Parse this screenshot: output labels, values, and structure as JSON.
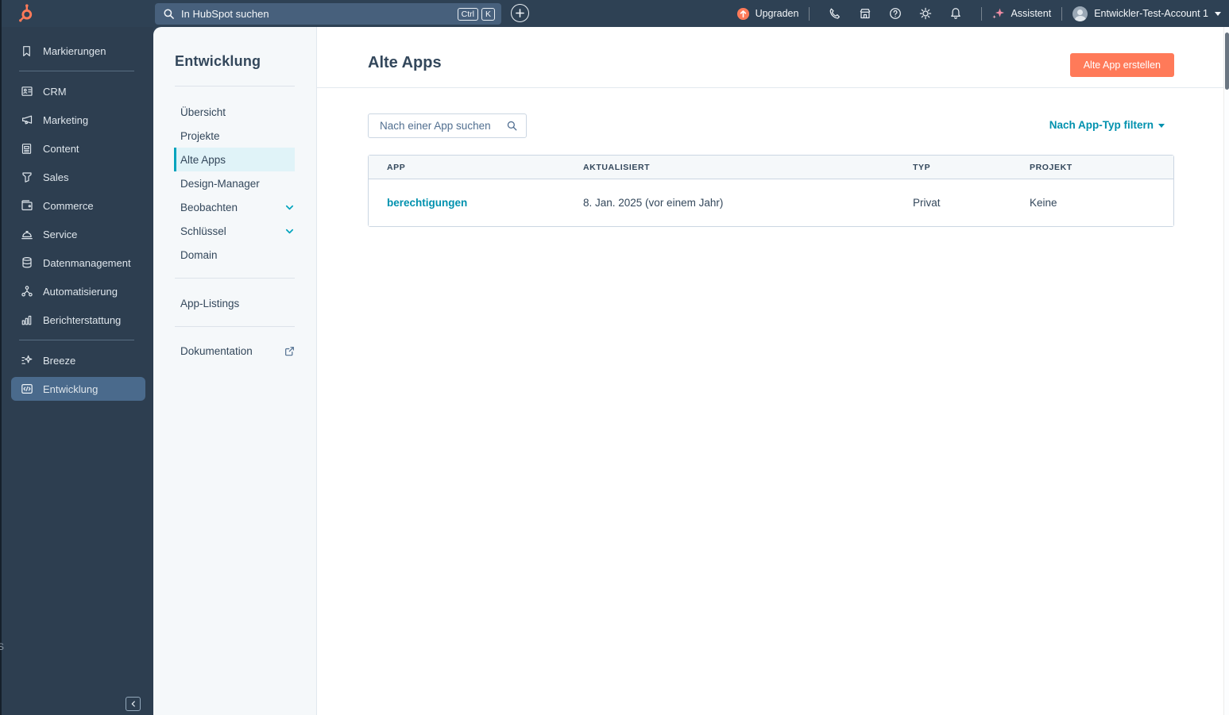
{
  "topbar": {
    "search_placeholder": "In HubSpot suchen",
    "shortcut_keys": [
      "Ctrl",
      "K"
    ],
    "upgrade_label": "Upgraden",
    "assistant_label": "Assistent",
    "account_label": "Entwickler-Test-Account 1",
    "icons": [
      "hubspot-logo",
      "search-icon",
      "plus-icon",
      "upgrade-icon",
      "phone-icon",
      "marketplace-icon",
      "help-icon",
      "gear-icon",
      "bell-icon",
      "sparkle-icon",
      "avatar",
      "caret-down-icon"
    ]
  },
  "sidebar": {
    "items": [
      {
        "label": "Markierungen",
        "icon": "bookmark-icon"
      },
      {
        "label": "CRM",
        "icon": "contact-card-icon"
      },
      {
        "label": "Marketing",
        "icon": "megaphone-icon"
      },
      {
        "label": "Content",
        "icon": "document-icon"
      },
      {
        "label": "Sales",
        "icon": "funnel-icon"
      },
      {
        "label": "Commerce",
        "icon": "wallet-icon"
      },
      {
        "label": "Service",
        "icon": "service-bell-icon"
      },
      {
        "label": "Datenmanagement",
        "icon": "database-icon"
      },
      {
        "label": "Automatisierung",
        "icon": "workflow-icon"
      },
      {
        "label": "Berichterstattung",
        "icon": "bar-chart-icon"
      },
      {
        "label": "Breeze",
        "icon": "breeze-sparkle-icon"
      },
      {
        "label": "Entwicklung",
        "icon": "code-icon",
        "selected": true
      }
    ],
    "edge_artifact": "S"
  },
  "subnav": {
    "title": "Entwicklung",
    "items": [
      {
        "label": "Übersicht"
      },
      {
        "label": "Projekte"
      },
      {
        "label": "Alte Apps",
        "selected": true
      },
      {
        "label": "Design-Manager"
      },
      {
        "label": "Beobachten",
        "expandable": true
      },
      {
        "label": "Schlüssel",
        "expandable": true
      },
      {
        "label": "Domain"
      }
    ],
    "listings_label": "App-Listings",
    "docs_label": "Dokumentation"
  },
  "main": {
    "title": "Alte Apps",
    "create_button_label": "Alte App erstellen",
    "search_placeholder": "Nach einer App suchen",
    "filter_label": "Nach App-Typ filtern",
    "table": {
      "headers": [
        "APP",
        "AKTUALISIERT",
        "TYP",
        "PROJEKT"
      ],
      "rows": [
        {
          "app": "berechtigungen",
          "updated": "8. Jan. 2025 (vor einem Jahr)",
          "type": "Privat",
          "project": "Keine"
        }
      ]
    }
  },
  "colors": {
    "topbar_bg": "#2e4154",
    "sidebar_bg": "#2d3e50",
    "sidebar_selected_bg": "#4a6a8c",
    "panel_bg": "#f5f8fa",
    "accent_orange": "#ff7a59",
    "link_teal": "#0091ae",
    "selected_teal_bar": "#00a4bd",
    "selected_item_bg": "#e0f3f8",
    "text_dark": "#33475b",
    "border_gray": "#cbd6e2"
  }
}
